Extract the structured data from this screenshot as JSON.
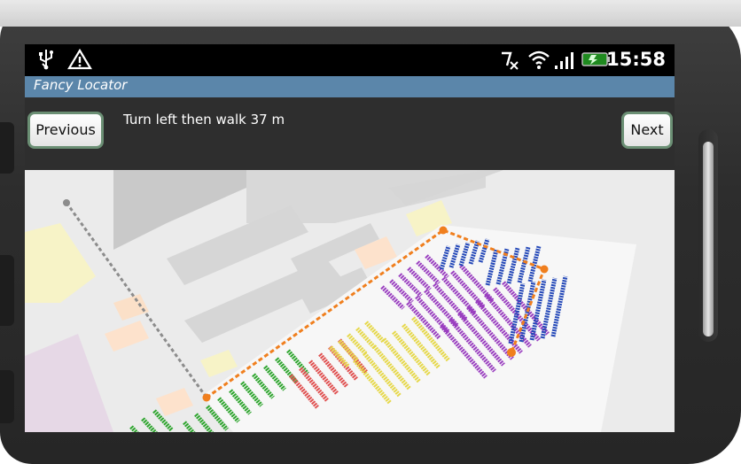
{
  "status_bar": {
    "icons": [
      "usb-icon",
      "warning-icon",
      "no-sound-icon",
      "wifi-icon",
      "signal-icon",
      "battery-icon"
    ],
    "time": "15:58"
  },
  "app": {
    "title": "Fancy Locator"
  },
  "navigation": {
    "previous_label": "Previous",
    "next_label": "Next",
    "instruction": "Turn left then walk 37 m"
  },
  "colors": {
    "title_bar": "#5b86aa",
    "route": "#f07f1e",
    "route_previous": "#8c8c8c",
    "section_green": "#2ea52e",
    "section_red": "#e05050",
    "section_yellow": "#e6d84a",
    "section_purple": "#9a3fc0",
    "section_blue": "#2448b8"
  }
}
